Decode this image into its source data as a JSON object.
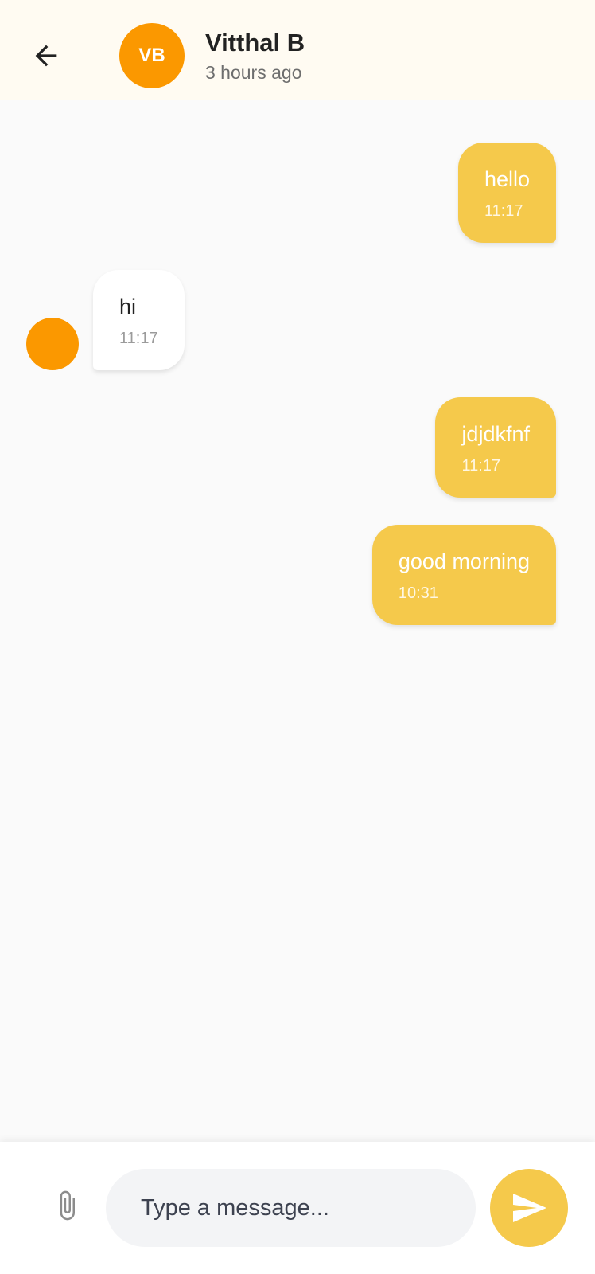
{
  "header": {
    "avatar_initials": "VB",
    "contact_name": "Vitthal B",
    "last_seen": "3 hours ago"
  },
  "messages": [
    {
      "direction": "outgoing",
      "text": "hello",
      "time": "11:17"
    },
    {
      "direction": "incoming",
      "text": "hi",
      "time": "11:17"
    },
    {
      "direction": "outgoing",
      "text": "jdjdkfnf",
      "time": "11:17"
    },
    {
      "direction": "outgoing",
      "text": "good morning",
      "time": "10:31"
    }
  ],
  "composer": {
    "placeholder": "Type a message...",
    "value": ""
  },
  "icons": {
    "back": "arrow-left-icon",
    "attach": "paperclip-icon",
    "send": "send-icon"
  },
  "colors": {
    "accent": "#f5c94b",
    "avatar": "#fb9800",
    "header_bg": "#fffbf2",
    "chat_bg": "#fafafa"
  }
}
